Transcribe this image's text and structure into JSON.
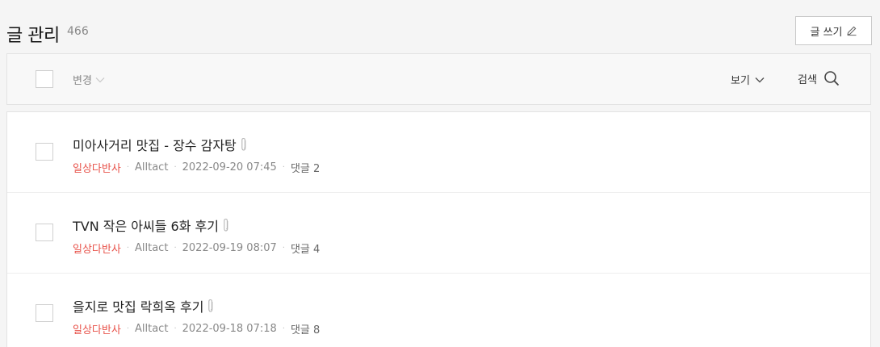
{
  "header": {
    "title": "글 관리",
    "count": "466",
    "write_label": "글 쓰기"
  },
  "toolbar": {
    "change_label": "변경",
    "view_label": "보기",
    "search_label": "검색"
  },
  "posts": [
    {
      "title": "미아사거리 맛집 - 장수 감자탕",
      "category": "일상다반사",
      "author": "Alltact",
      "datetime": "2022-09-20 07:45",
      "comments": "댓글 2"
    },
    {
      "title": "TVN 작은 아씨들 6화 후기",
      "category": "일상다반사",
      "author": "Alltact",
      "datetime": "2022-09-19 08:07",
      "comments": "댓글 4"
    },
    {
      "title": "을지로 맛집 락희옥 후기",
      "category": "일상다반사",
      "author": "Alltact",
      "datetime": "2022-09-18 07:18",
      "comments": "댓글 8"
    }
  ],
  "colors": {
    "category": "#e8524a",
    "meta": "#888888",
    "border": "#e3e3e3"
  },
  "icons": [
    "pencil-icon",
    "chevron-down-icon",
    "search-icon",
    "paperclip-icon"
  ]
}
